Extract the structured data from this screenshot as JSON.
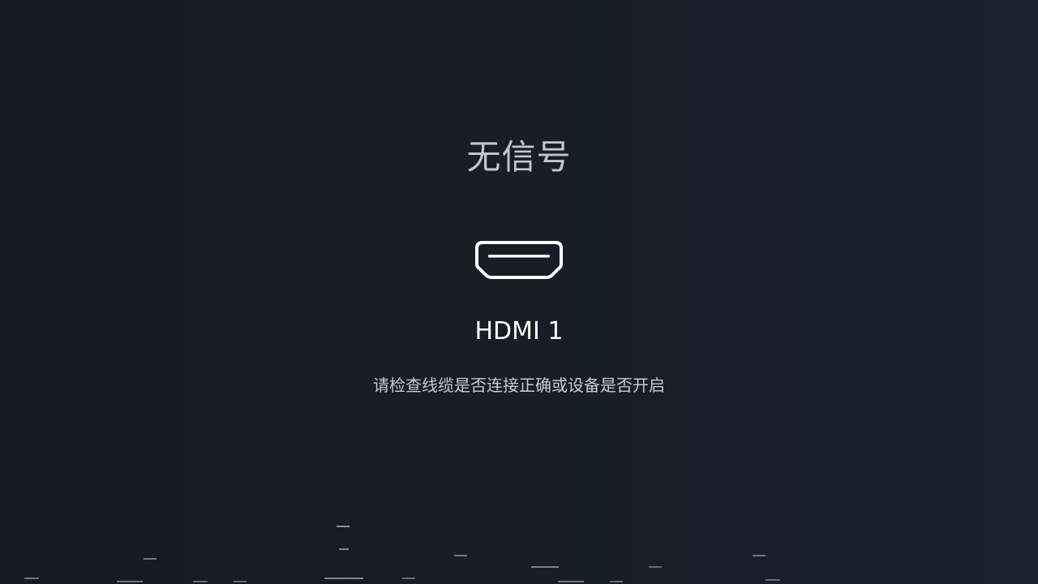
{
  "screen": {
    "title": "无信号",
    "port_name": "HDMI 1",
    "hint": "请检查线缆是否连接正确或设备是否开启",
    "icon": "hdmi-port-icon"
  },
  "colors": {
    "background": "#181d26",
    "title_text": "#c3c6cc",
    "port_text": "#ffffff",
    "hint_text": "#c9ccd2",
    "icon_stroke": "#ffffff"
  }
}
